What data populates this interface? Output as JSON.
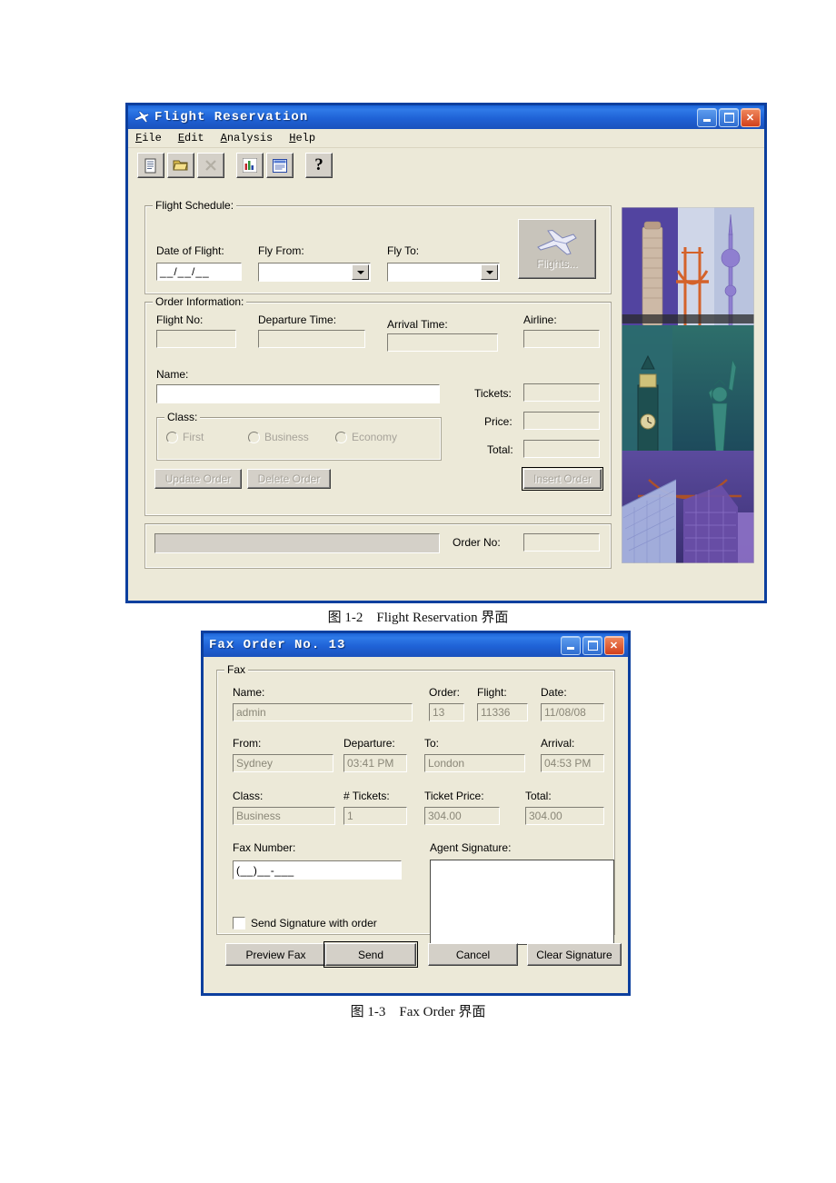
{
  "flight_window": {
    "title": "Flight Reservation",
    "title_icon": "plane-icon",
    "window_buttons": {
      "minimize": "minimize-icon",
      "maximize": "maximize-icon",
      "close": "close-icon"
    },
    "menu": [
      {
        "label": "File",
        "accel": "F"
      },
      {
        "label": "Edit",
        "accel": "E"
      },
      {
        "label": "Analysis",
        "accel": "A"
      },
      {
        "label": "Help",
        "accel": "H"
      }
    ],
    "toolbar": [
      {
        "name": "new-order-icon",
        "enabled": true
      },
      {
        "name": "open-order-icon",
        "enabled": true
      },
      {
        "name": "delete-order-icon",
        "enabled": false
      },
      {
        "name": "graph-icon",
        "enabled": true
      },
      {
        "name": "fax-order-icon",
        "enabled": true
      },
      {
        "name": "help-icon",
        "enabled": true,
        "glyph": "?"
      }
    ],
    "flight_schedule": {
      "legend": "Flight Schedule:",
      "date_label": "Date of Flight:",
      "date_value": "__/__/__",
      "fly_from_label": "Fly From:",
      "fly_from_value": "",
      "fly_to_label": "Fly To:",
      "fly_to_value": "",
      "flights_button": "Flights..."
    },
    "order_information": {
      "legend": "Order Information:",
      "flight_no_label": "Flight No:",
      "flight_no_value": "",
      "departure_time_label": "Departure Time:",
      "departure_time_value": "",
      "arrival_time_label": "Arrival Time:",
      "arrival_time_value": "",
      "airline_label": "Airline:",
      "airline_value": "",
      "name_label": "Name:",
      "name_value": "",
      "tickets_label": "Tickets:",
      "tickets_value": "",
      "price_label": "Price:",
      "price_value": "",
      "total_label": "Total:",
      "total_value": "",
      "class_legend": "Class:",
      "class_options": [
        "First",
        "Business",
        "Economy"
      ],
      "class_selected": "",
      "update_order_button": "Update Order",
      "delete_order_button": "Delete Order",
      "insert_order_button": "Insert Order"
    },
    "status_bar": {
      "message": "",
      "order_no_label": "Order No:",
      "order_no_value": ""
    }
  },
  "flight_caption": "图 1-2　Flight Reservation 界面",
  "fax_window": {
    "title": "Fax Order No. 13",
    "window_buttons": {
      "minimize": "minimize-icon",
      "maximize": "maximize-icon",
      "close": "close-icon"
    },
    "fax_group_legend": "Fax",
    "fields": {
      "name_label": "Name:",
      "name_value": "admin",
      "order_label": "Order:",
      "order_value": "13",
      "flight_label": "Flight:",
      "flight_value": "11336",
      "date_label": "Date:",
      "date_value": "11/08/08",
      "from_label": "From:",
      "from_value": "Sydney",
      "departure_label": "Departure:",
      "departure_value": "03:41 PM",
      "to_label": "To:",
      "to_value": "London",
      "arrival_label": "Arrival:",
      "arrival_value": "04:53 PM",
      "class_label": "Class:",
      "class_value": "Business",
      "tickets_label": "# Tickets:",
      "tickets_value": "1",
      "ticket_price_label": "Ticket Price:",
      "ticket_price_value": "304.00",
      "total_label": "Total:",
      "total_value": "304.00",
      "fax_number_label": "Fax Number:",
      "fax_number_value": "(__)__-___",
      "agent_signature_label": "Agent Signature:",
      "agent_signature_value": ""
    },
    "send_signature_checkbox": "Send Signature with order",
    "send_signature_checked": false,
    "buttons": {
      "preview_fax": "Preview Fax",
      "send": "Send",
      "cancel": "Cancel",
      "clear_signature": "Clear Signature"
    }
  },
  "fax_caption": "图 1-3　Fax Order 界面",
  "colors": {
    "title_blue": "#1f62d6",
    "window_border": "#0c3f9e",
    "face": "#ece9d8",
    "button_face": "#d4d0c8",
    "disabled_text": "#a7a39a"
  }
}
